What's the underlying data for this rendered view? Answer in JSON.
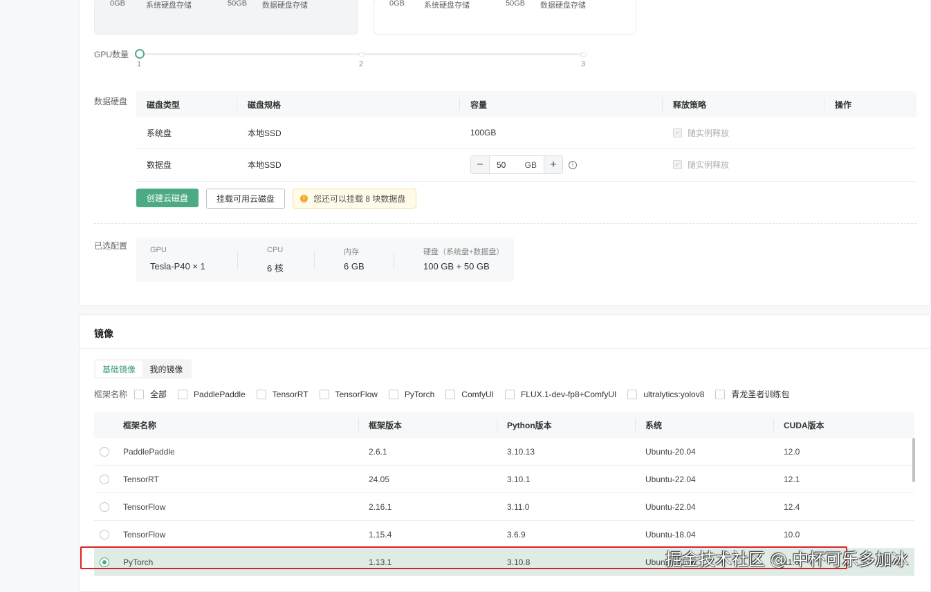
{
  "summary_cards": [
    {
      "system_size": "0GB",
      "system_label": "系统硬盘存储",
      "data_size": "50GB",
      "data_label": "数据硬盘存储"
    },
    {
      "system_size": "0GB",
      "system_label": "系统硬盘存储",
      "data_size": "50GB",
      "data_label": "数据硬盘存储"
    }
  ],
  "gpu": {
    "label": "GPU数量",
    "ticks": [
      "1",
      "2",
      "3"
    ],
    "selected": 1
  },
  "data_disk": {
    "label": "数据硬盘",
    "columns": [
      "磁盘类型",
      "磁盘规格",
      "容量",
      "释放策略",
      "操作"
    ],
    "rows": [
      {
        "type": "系统盘",
        "spec": "本地SSD",
        "capacity": "100GB",
        "policy": "随实例释放"
      },
      {
        "type": "数据盘",
        "spec": "本地SSD",
        "capacity_value": "50",
        "capacity_unit": "GB",
        "policy": "随实例释放"
      }
    ],
    "create_button": "创建云磁盘",
    "mount_button": "挂载可用云磁盘",
    "notice": "您还可以挂载 8 块数据盘"
  },
  "selected_config": {
    "label": "已选配置",
    "items": [
      {
        "key": "GPU",
        "value": "Tesla-P40 × 1"
      },
      {
        "key": "CPU",
        "value": "6 核"
      },
      {
        "key": "内存",
        "value": "6 GB"
      },
      {
        "key": "硬盘（系统盘+数据盘）",
        "value": "100 GB + 50 GB"
      }
    ]
  },
  "image_section": {
    "title": "镜像",
    "tabs": [
      "基础镜像",
      "我的镜像"
    ],
    "active_tab": "基础镜像",
    "filter_label": "框架名称",
    "filters": [
      "全部",
      "PaddlePaddle",
      "TensorRT",
      "TensorFlow",
      "PyTorch",
      "ComfyUI",
      "FLUX.1-dev-fp8+ComfyUI",
      "ultralytics:yolov8",
      "青龙圣者训练包"
    ],
    "columns": [
      "框架名称",
      "框架版本",
      "Python版本",
      "系统",
      "CUDA版本"
    ],
    "rows": [
      {
        "name": "PaddlePaddle",
        "version": "2.6.1",
        "python": "3.10.13",
        "os": "Ubuntu-20.04",
        "cuda": "12.0",
        "selected": false
      },
      {
        "name": "TensorRT",
        "version": "24.05",
        "python": "3.10.1",
        "os": "Ubuntu-22.04",
        "cuda": "12.1",
        "selected": false
      },
      {
        "name": "TensorFlow",
        "version": "2.16.1",
        "python": "3.11.0",
        "os": "Ubuntu-22.04",
        "cuda": "12.4",
        "selected": false
      },
      {
        "name": "TensorFlow",
        "version": "1.15.4",
        "python": "3.6.9",
        "os": "Ubuntu-18.04",
        "cuda": "10.0",
        "selected": false
      },
      {
        "name": "PyTorch",
        "version": "1.13.1",
        "python": "3.10.8",
        "os": "Ubuntu-20.04",
        "cuda": "11.6",
        "selected": true
      }
    ]
  },
  "watermark": "掘金技术社区 @ 中杯可乐多加冰",
  "colors": {
    "accent": "#4caa85",
    "highlight_border": "#e02020",
    "warning": "#f2a92c"
  }
}
